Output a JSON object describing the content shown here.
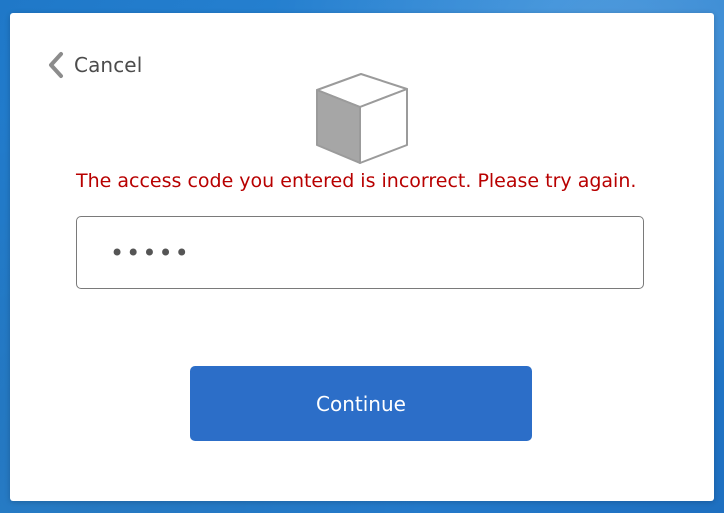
{
  "header": {
    "cancel_label": "Cancel",
    "cancel_icon": "chevron-left-icon"
  },
  "main": {
    "illustration_icon": "cube-icon",
    "error_message": "The access code you entered is incorrect. Please try again.",
    "access_code_field": {
      "value": "•••••",
      "type": "password"
    },
    "continue_label": "Continue"
  },
  "colors": {
    "background": "#2a86d6",
    "card": "#ffffff",
    "error": "#b80000",
    "primary_button": "#2c6ec8",
    "icon_gray": "#8c8c8c"
  }
}
